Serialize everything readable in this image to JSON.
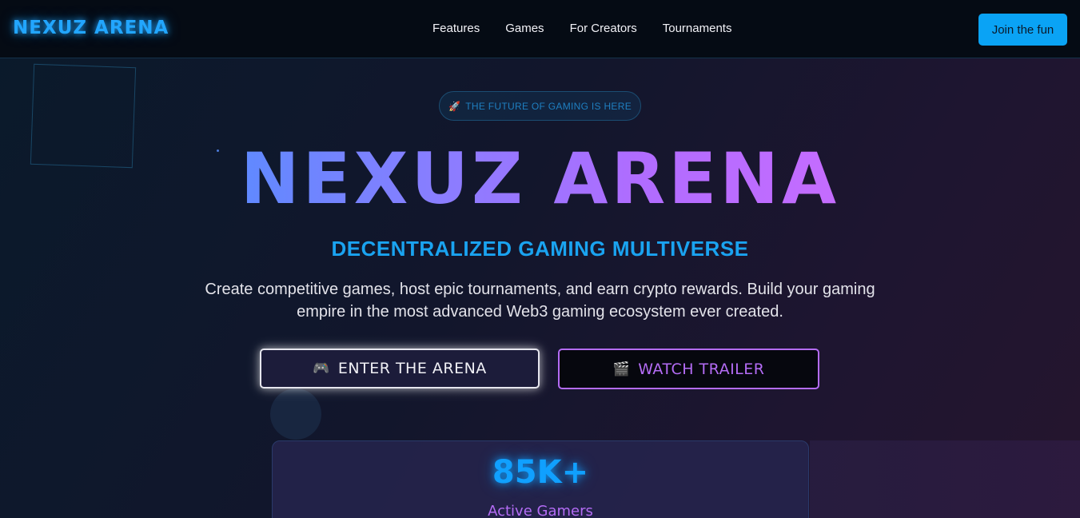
{
  "nav": {
    "brand": "NEXUZ ARENA",
    "links": [
      "Features",
      "Games",
      "For Creators",
      "Tournaments"
    ],
    "cta": "Join the fun"
  },
  "hero": {
    "pill_icon": "rocket-icon",
    "pill_text": "THE FUTURE OF GAMING IS HERE",
    "title": "NEXUZ ARENA",
    "subtitle": "DECENTRALIZED GAMING MULTIVERSE",
    "description": "Create competitive games, host epic tournaments, and earn crypto rewards. Build your gaming empire in the most advanced Web3 gaming ecosystem ever created.",
    "primary_button": {
      "icon": "gamepad-icon",
      "label": "ENTER THE ARENA"
    },
    "secondary_button": {
      "icon": "clapperboard-icon",
      "label": "WATCH TRAILER"
    }
  },
  "stats": [
    {
      "value": "85K+",
      "label": "Active Gamers"
    }
  ],
  "colors": {
    "accent_blue": "#10a0ff",
    "accent_purple": "#b46cf5",
    "cta_bg": "#0aa3f5"
  }
}
